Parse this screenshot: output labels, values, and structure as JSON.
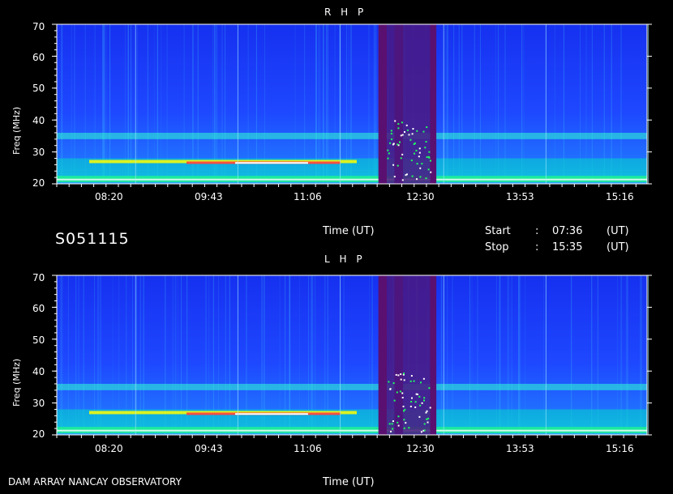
{
  "meta": {
    "event_id": "S051115",
    "footer": "DAM ARRAY  NANCAY OBSERVATORY",
    "start": {
      "label": "Start",
      "sep": ":",
      "value": "07:36",
      "unit": "(UT)"
    },
    "stop": {
      "label": "Stop",
      "sep": ":",
      "value": "15:35",
      "unit": "(UT)"
    },
    "xlabel": "Time (UT)"
  },
  "chart_data": [
    {
      "type": "heatmap",
      "title": "R H P",
      "ylabel": "Freq (MHz)",
      "xlabel": "Time (UT)",
      "x_ticks": [
        "08:20",
        "09:43",
        "11:06",
        "12:30",
        "13:53",
        "15:16"
      ],
      "y_ticks": [
        20,
        30,
        40,
        50,
        60,
        70
      ],
      "ylim": [
        20,
        70
      ],
      "time_range": [
        "07:36",
        "15:35"
      ],
      "colormap": [
        "#1e3cff",
        "#00c8ff",
        "#00ff60",
        "#ffff00",
        "#ff4040",
        "#ffffff"
      ],
      "features": {
        "interference_band_mhz": [
          34,
          36
        ],
        "bright_band_mhz": [
          21,
          28
        ],
        "dark_gaps_utc": [
          [
            "11:57",
            "12:04"
          ],
          [
            "12:10",
            "12:17"
          ],
          [
            "12:39",
            "12:44"
          ]
        ]
      }
    },
    {
      "type": "heatmap",
      "title": "L H P",
      "ylabel": "Freq (MHz)",
      "xlabel": "Time (UT)",
      "x_ticks": [
        "08:20",
        "09:43",
        "11:06",
        "12:30",
        "13:53",
        "15:16"
      ],
      "y_ticks": [
        20,
        30,
        40,
        50,
        60,
        70
      ],
      "ylim": [
        20,
        70
      ],
      "time_range": [
        "07:36",
        "15:35"
      ],
      "colormap": [
        "#1e3cff",
        "#00c8ff",
        "#00ff60",
        "#ffff00",
        "#ff4040",
        "#ffffff"
      ],
      "features": {
        "interference_band_mhz": [
          34,
          36
        ],
        "bright_band_mhz": [
          21,
          28
        ],
        "dark_gaps_utc": [
          [
            "11:57",
            "12:04"
          ],
          [
            "12:10",
            "12:17"
          ],
          [
            "12:39",
            "12:44"
          ]
        ]
      }
    }
  ]
}
